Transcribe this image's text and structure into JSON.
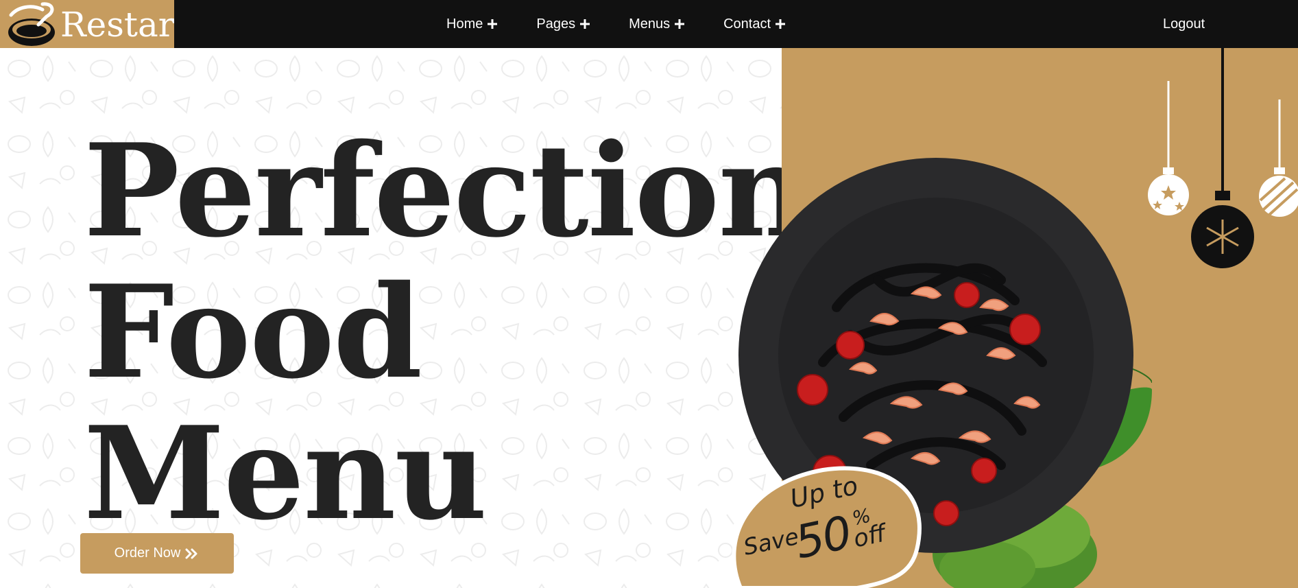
{
  "brand": {
    "name": "Restar",
    "logo_icon": "bowl-spoon-logo"
  },
  "nav": {
    "items": [
      {
        "label": "Home",
        "icon": "plus-icon"
      },
      {
        "label": "Pages",
        "icon": "plus-icon"
      },
      {
        "label": "Menus",
        "icon": "plus-icon"
      },
      {
        "label": "Contact",
        "icon": "plus-icon"
      }
    ],
    "logout": "Logout"
  },
  "hero": {
    "headline": [
      "Perfection",
      "Food",
      "Menu"
    ],
    "cta": {
      "label": "Order Now",
      "icon": "double-chevron-right-icon"
    }
  },
  "promo": {
    "up_to": "Up to",
    "save": "Save",
    "amount": "50",
    "percent": "%",
    "off": "off"
  },
  "colors": {
    "accent": "#c69c5f",
    "navbar": "#111111",
    "text_dark": "#232323"
  }
}
